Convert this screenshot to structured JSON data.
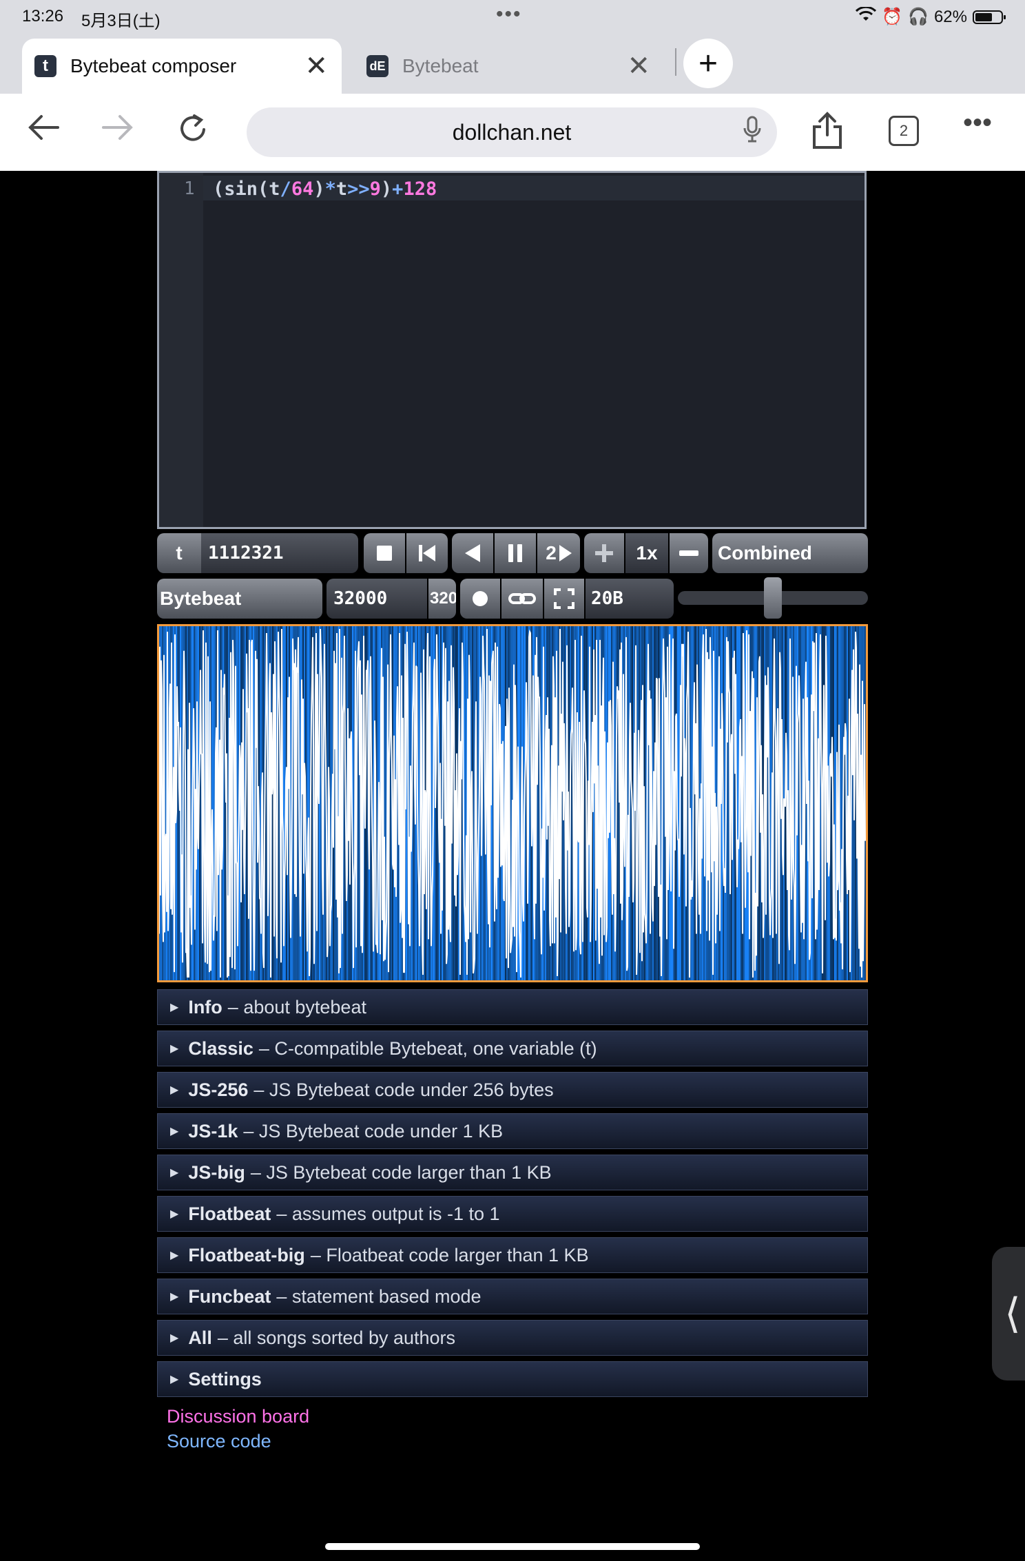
{
  "status_bar": {
    "time": "13:26",
    "date": "5月3日(土)",
    "battery": "62%"
  },
  "browser": {
    "tabs": [
      {
        "label": "Bytebeat composer",
        "icon": "t",
        "active": true
      },
      {
        "label": "Bytebeat",
        "icon": "dE",
        "active": false
      }
    ],
    "tab_count": "2",
    "url": "dollchan.net"
  },
  "editor": {
    "line_number": "1",
    "code_tokens": [
      {
        "text": "(sin(t",
        "cls": ""
      },
      {
        "text": "/",
        "cls": "tok-op"
      },
      {
        "text": "64",
        "cls": "tok-num"
      },
      {
        "text": ")",
        "cls": ""
      },
      {
        "text": "*",
        "cls": "tok-op"
      },
      {
        "text": "t",
        "cls": ""
      },
      {
        "text": ">>",
        "cls": "tok-op"
      },
      {
        "text": "9",
        "cls": "tok-num"
      },
      {
        "text": ")",
        "cls": ""
      },
      {
        "text": "+",
        "cls": "tok-op"
      },
      {
        "text": "128",
        "cls": "tok-num"
      }
    ]
  },
  "controls": {
    "t_label": "t",
    "t_value": "1112321",
    "rewind_speed": "2",
    "playback_speed": "1x",
    "draw_mode": "Combined",
    "mode": "Bytebeat",
    "sample_rate": "32000",
    "sample_rate_preset": "320",
    "code_size": "20B",
    "volume_level": 0.5
  },
  "library": [
    {
      "title": "Info",
      "desc": "– about bytebeat"
    },
    {
      "title": "Classic",
      "desc": "– C-compatible Bytebeat, one variable (t)"
    },
    {
      "title": "JS-256",
      "desc": "– JS Bytebeat code under 256 bytes"
    },
    {
      "title": "JS-1k",
      "desc": "– JS Bytebeat code under 1 KB"
    },
    {
      "title": "JS-big",
      "desc": "– JS Bytebeat code larger than 1 KB"
    },
    {
      "title": "Floatbeat",
      "desc": "– assumes output is -1 to 1"
    },
    {
      "title": "Floatbeat-big",
      "desc": "– Floatbeat code larger than 1 KB"
    },
    {
      "title": "Funcbeat",
      "desc": "– statement based mode"
    },
    {
      "title": "All",
      "desc": "– all songs sorted by authors"
    },
    {
      "title": "Settings",
      "desc": ""
    }
  ],
  "links": {
    "discussion": "Discussion board",
    "source": "Source code"
  },
  "colors": {
    "accent_orange": "#f39a3c",
    "wave_blue": "#1a86ff",
    "link_pink": "#ff72e8",
    "link_blue": "#7fb7ff"
  }
}
